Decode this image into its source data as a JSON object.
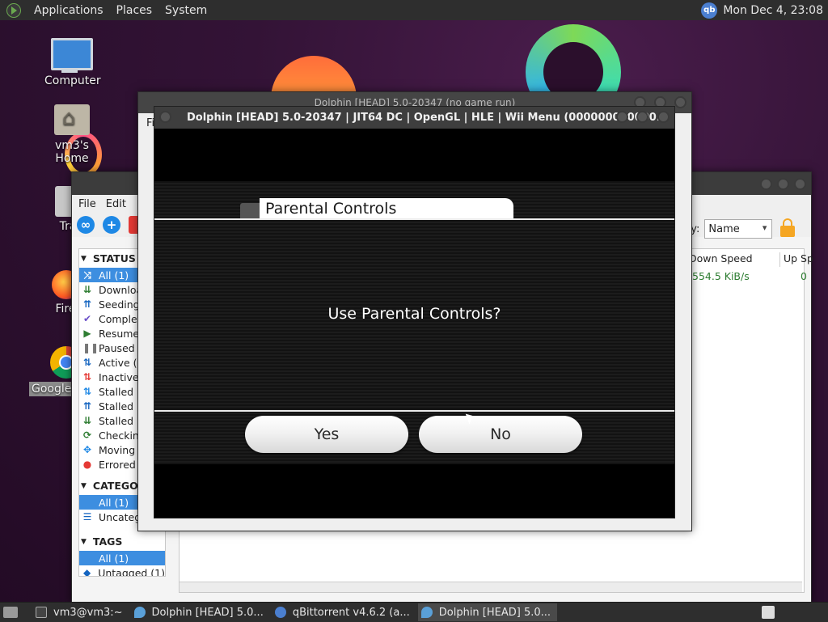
{
  "top_panel": {
    "menu": [
      "Applications",
      "Places",
      "System"
    ],
    "clock": "Mon Dec  4, 23:08",
    "tray_icon_text": "qb"
  },
  "desktop_icons": {
    "computer": "Computer",
    "home": "vm3's Home",
    "trash": "Tra",
    "firefox": "Fire",
    "chrome": "Google"
  },
  "qbittorrent": {
    "menu": [
      "File",
      "Edit"
    ],
    "sort_label": "by:",
    "sort_value": "Name",
    "status_header": "STATUS",
    "status_items": [
      {
        "label": "All (1)",
        "icon": "shuffle-icon",
        "color": "#2e7d32"
      },
      {
        "label": "Downloa",
        "icon": "download-icon",
        "color": "#2e7d32"
      },
      {
        "label": "Seeding",
        "icon": "seeding-icon",
        "color": "#1565c0"
      },
      {
        "label": "Complet",
        "icon": "check-icon",
        "color": "#6a4fc9"
      },
      {
        "label": "Resumed",
        "icon": "play-icon",
        "color": "#2e7d32"
      },
      {
        "label": "Paused (",
        "icon": "pause-icon",
        "color": "#777777"
      },
      {
        "label": "Active (1",
        "icon": "updown-icon",
        "color": "#1565c0"
      },
      {
        "label": "Inactive",
        "icon": "updown-red-icon",
        "color": "#e53935"
      },
      {
        "label": "Stalled (",
        "icon": "stalled-icon",
        "color": "#1e88e5"
      },
      {
        "label": "Stalled U",
        "icon": "stalled-up-icon",
        "color": "#1565c0"
      },
      {
        "label": "Stalled D",
        "icon": "stalled-down-icon",
        "color": "#2e7d32"
      },
      {
        "label": "Checking",
        "icon": "refresh-icon",
        "color": "#2e7d32"
      },
      {
        "label": "Moving (",
        "icon": "move-icon",
        "color": "#1e88e5"
      },
      {
        "label": "Errored (",
        "icon": "error-icon",
        "color": "#e53935"
      }
    ],
    "categories_header": "CATEGO",
    "category_items": [
      "All (1)",
      "Uncateg"
    ],
    "tags_header": "TAGS",
    "tag_items": [
      "All (1)",
      "Untagged (1)"
    ],
    "columns": [
      "Down Speed",
      "Up Sp"
    ],
    "row": {
      "down_speed": "554.5 KiB/s",
      "up_speed": "0"
    }
  },
  "dolphin_back": {
    "title": "Dolphin [HEAD] 5.0-20347 (no game run)",
    "menu_first": "Fi"
  },
  "dolphin_front": {
    "title": "Dolphin [HEAD] 5.0-20347 | JIT64 DC | OpenGL | HLE | Wii Menu (000000010000...",
    "tab_label": "Parental Controls",
    "question": "Use Parental Controls?",
    "yes_label": "Yes",
    "no_label": "No"
  },
  "taskbar": {
    "tasks": [
      {
        "label": "vm3@vm3:~",
        "active": false
      },
      {
        "label": "Dolphin [HEAD] 5.0...",
        "active": false
      },
      {
        "label": "qBittorrent v4.6.2 (a...",
        "active": false
      },
      {
        "label": "Dolphin [HEAD] 5.0...",
        "active": true
      }
    ]
  }
}
